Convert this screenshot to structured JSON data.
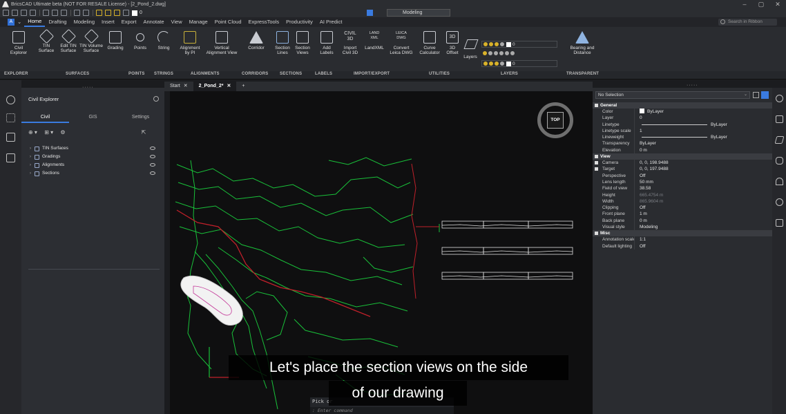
{
  "window": {
    "title": "BricsCAD Ultimate beta (NOT FOR RESALE License) - [2_Pond_2.dwg]",
    "controls": [
      "–",
      "▢",
      "✕"
    ]
  },
  "quick_access": {
    "layer_name": "0",
    "workspace": "Modeling"
  },
  "ribbon_tabs": [
    "Home",
    "Drafting",
    "Modeling",
    "Insert",
    "Export",
    "Annotate",
    "View",
    "Manage",
    "Point Cloud",
    "ExpressTools",
    "Productivity",
    "AI Predict"
  ],
  "ribbon_search_placeholder": "Search in Ribbon",
  "ribbon_buttons": [
    {
      "label": "Civil\nExplorer",
      "icon": "civil-explorer-icon"
    },
    {
      "label": "TIN\nSurface",
      "icon": "tin-surface-icon"
    },
    {
      "label": "Edit TIN\nSurface",
      "icon": "edit-tin-surface-icon"
    },
    {
      "label": "TIN Volume\nSurface",
      "icon": "tin-volume-surface-icon"
    },
    {
      "label": "Grading",
      "icon": "grading-icon"
    },
    {
      "label": "Points",
      "icon": "points-icon"
    },
    {
      "label": "String",
      "icon": "string-icon"
    },
    {
      "label": "Alignment\nby PI",
      "icon": "alignment-by-pi-icon"
    },
    {
      "label": "Vertical\nAlignment View",
      "icon": "vertical-alignment-view-icon"
    },
    {
      "label": "Corridor",
      "icon": "corridor-icon"
    },
    {
      "label": "Section\nLines",
      "icon": "section-lines-icon"
    },
    {
      "label": "Section\nViews",
      "icon": "section-views-icon"
    },
    {
      "label": "Add\nLabels",
      "icon": "add-labels-icon"
    },
    {
      "label": "Import\nCivil 3D",
      "icon": "import-civil3d-icon"
    },
    {
      "label": "LandXML",
      "icon": "landxml-icon"
    },
    {
      "label": "Convert\nLeica DWG",
      "icon": "convert-leica-icon"
    },
    {
      "label": "Curve\nCalculator",
      "icon": "curve-calculator-icon"
    },
    {
      "label": "3D\nOffset",
      "icon": "3d-offset-icon"
    },
    {
      "label": "Layers",
      "icon": "layers-icon"
    },
    {
      "label": "Bearing and\nDistance",
      "icon": "bearing-distance-icon"
    }
  ],
  "ribbon_icon_text": {
    "civil3d": "CIVIL\n3D",
    "landxml": "LAND\nXML",
    "leica": "LEICA\nDWG",
    "offset3d": "3D"
  },
  "ribbon_groups": [
    "EXPLORER",
    "SURFACES",
    "POINTS",
    "STRINGS",
    "ALIGNMENTS",
    "CORRIDORS",
    "SECTIONS",
    "LABELS",
    "IMPORT/EXPORT",
    "UTILITIES",
    "LAYERS",
    "TRANSPARENT"
  ],
  "layer_rows": {
    "row1": "0",
    "row3": "0"
  },
  "explorer": {
    "title": "Civil Explorer",
    "tabs": [
      "Civil",
      "GIS",
      "Settings"
    ],
    "tree": [
      {
        "label": "TIN Surfaces"
      },
      {
        "label": "Gradings"
      },
      {
        "label": "Alignments"
      },
      {
        "label": "Sections"
      }
    ]
  },
  "doc_tabs": [
    {
      "label": "Start",
      "active": false
    },
    {
      "label": "2_Pond_2*",
      "active": true
    },
    {
      "label": "+",
      "active": false
    }
  ],
  "viewcube_label": "TOP",
  "command_line": {
    "history": "Pick or",
    "placeholder": ": Enter command"
  },
  "caption": {
    "line1": "Let's place the section views on the side",
    "line2": "of our drawing"
  },
  "properties": {
    "selection": "No Selection",
    "sections": [
      {
        "name": "General",
        "rows": [
          {
            "key": "Color",
            "value": "ByLayer",
            "swatch": true
          },
          {
            "key": "Layer",
            "value": "0"
          },
          {
            "key": "Linetype",
            "value": "ByLayer",
            "line": true
          },
          {
            "key": "Linetype scale",
            "value": "1"
          },
          {
            "key": "Lineweight",
            "value": "ByLayer",
            "line": true
          },
          {
            "key": "Transparency",
            "value": "ByLayer"
          },
          {
            "key": "Elevation",
            "value": "0 m"
          }
        ]
      },
      {
        "name": "View",
        "rows": [
          {
            "key": "Camera",
            "value": "0, 0, 198.9488",
            "expand": true
          },
          {
            "key": "Target",
            "value": "0, 0, 197.9488",
            "expand": true
          },
          {
            "key": "Perspective",
            "value": "Off"
          },
          {
            "key": "Lens length",
            "value": "50 mm"
          },
          {
            "key": "Field of view",
            "value": "38.58"
          },
          {
            "key": "Height",
            "value": "665.4754 m",
            "dim": true
          },
          {
            "key": "Width",
            "value": "865.9604 m",
            "dim": true
          },
          {
            "key": "Clipping",
            "value": "Off"
          },
          {
            "key": "Front plane",
            "value": "1 m"
          },
          {
            "key": "Back plane",
            "value": "0 m"
          },
          {
            "key": "Visual style",
            "value": "Modeling"
          }
        ]
      },
      {
        "name": "Misc",
        "rows": [
          {
            "key": "Annotation scale",
            "value": "1:1"
          },
          {
            "key": "Default lighting",
            "value": "Off"
          }
        ]
      }
    ]
  },
  "colors": {
    "accent": "#3a7be0",
    "contour_green": "#19c23a",
    "contour_red": "#c0202a",
    "section_views": "#e0e0e0"
  }
}
